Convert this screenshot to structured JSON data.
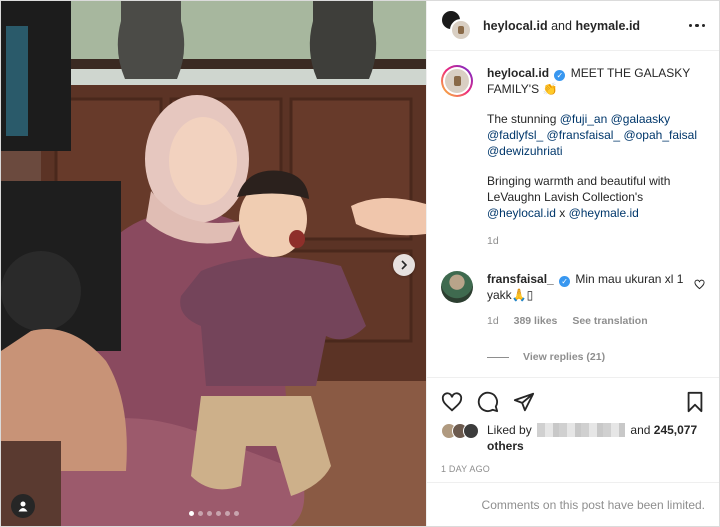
{
  "header": {
    "user1": "heylocal.id",
    "and": "and",
    "user2": "heymale.id"
  },
  "caption": {
    "username": "heylocal.id",
    "verified_mark": "✓",
    "headline": "MEET THE GALASKY FAMILY'S",
    "headline_emoji": "👏",
    "para1_prefix": "The stunning",
    "mentions": [
      "@fuji_an",
      "@galaasky",
      "@fadlyfsl_",
      "@fransfaisal_",
      "@opah_faisal",
      "@dewizuhriati"
    ],
    "para2_line1": "Bringing warmth and beautiful with",
    "para2_line2": "LeVaughn Lavish Collection's",
    "collab_mention1": "@heylocal.id",
    "collab_x": "x",
    "collab_mention2": "@heymale.id",
    "time": "1d"
  },
  "comment": {
    "username": "fransfaisal_",
    "verified_mark": "✓",
    "text": "Min mau ukuran xl 1 yakk",
    "emoji": "🙏",
    "box": "▯",
    "time": "1d",
    "likes": "389 likes",
    "translate": "See translation",
    "replies": "View replies (21)"
  },
  "likes": {
    "prefix": "Liked by",
    "and": "and",
    "count": "245,077",
    "others": "others"
  },
  "post_time": "1 DAY AGO",
  "comments_notice": "Comments on this post have been limited.",
  "carousel": {
    "dots": 6,
    "active_index": 0
  },
  "colors": {
    "mention": "#00376b",
    "verified": "#3897f0",
    "muted": "#8e8e8e"
  }
}
